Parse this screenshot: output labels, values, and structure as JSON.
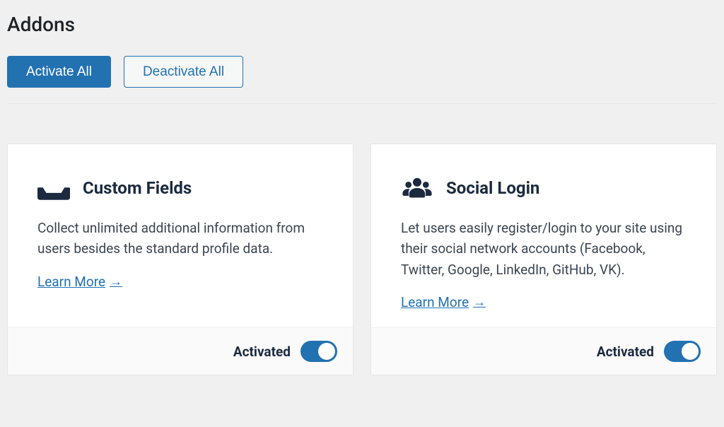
{
  "page": {
    "title": "Addons"
  },
  "actions": {
    "activate_all": "Activate All",
    "deactivate_all": "Deactivate All"
  },
  "common": {
    "learn_more": "Learn More",
    "activated": "Activated"
  },
  "cards": [
    {
      "id": "custom-fields",
      "title": "Custom Fields",
      "description": "Collect unlimited additional information from users besides the standard profile data.",
      "icon": "inbox-icon",
      "activated": true
    },
    {
      "id": "social-login",
      "title": "Social Login",
      "description": "Let users easily register/login to your site using their social network accounts (Facebook, Twitter, Google, LinkedIn, GitHub, VK).",
      "icon": "users-icon",
      "activated": true
    }
  ]
}
